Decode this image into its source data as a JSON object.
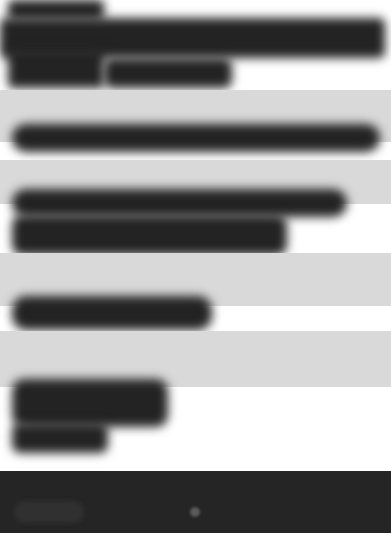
{
  "list": {
    "sections": [
      {
        "label": "",
        "value": ""
      },
      {
        "label": "",
        "value": ""
      },
      {
        "label": "",
        "value": ""
      },
      {
        "label": "",
        "value": ""
      }
    ],
    "expanded_text": ""
  },
  "footer": {
    "left_label": "",
    "center_icon": "dot-icon"
  },
  "colors": {
    "ink": "#232323",
    "band": "#d9d9d9",
    "footer": "#252525",
    "background": "#ffffff"
  }
}
